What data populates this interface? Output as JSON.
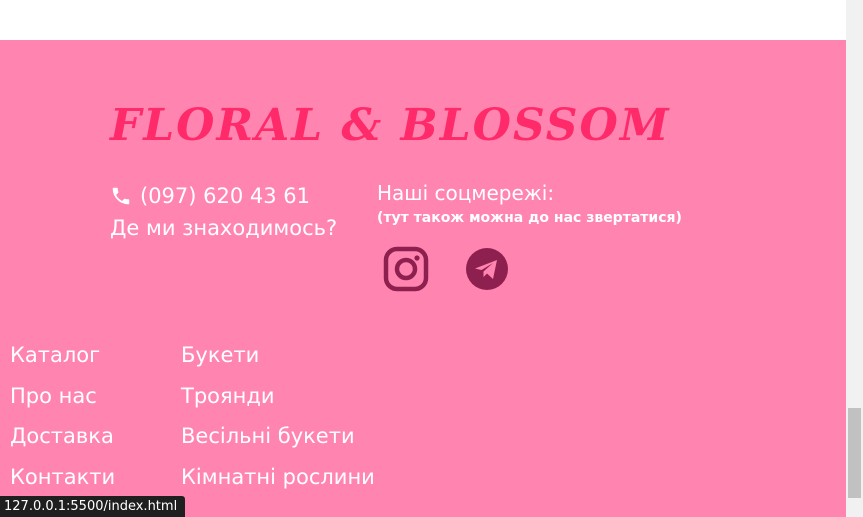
{
  "brand": {
    "logo_text": "FLORAL & BLOSSOM",
    "color": "#ff2a6a"
  },
  "theme": {
    "footer_bg": "#ff85b0",
    "icon_color": "#8e2050"
  },
  "contact": {
    "phone_icon": "phone-icon",
    "phone": "(097) 620 43 61",
    "location_link": "Де ми знаходимось?"
  },
  "social": {
    "title": "Наші соцмережі:",
    "note": "(тут також можна до нас звертатися)",
    "icons": [
      "instagram-icon",
      "telegram-icon"
    ]
  },
  "nav": {
    "main": [
      "Каталог",
      "Про нас",
      "Доставка",
      "Контакти"
    ],
    "categories": [
      "Букети",
      "Троянди",
      "Весільні букети",
      "Кімнатні рослини"
    ]
  },
  "statusbar": {
    "url": "127.0.0.1:5500/index.html"
  }
}
